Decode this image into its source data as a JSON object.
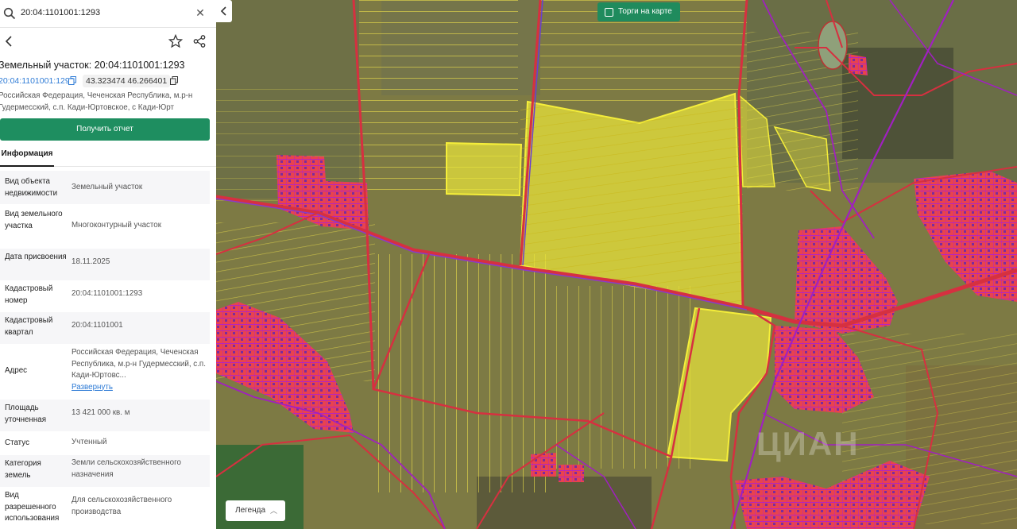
{
  "search": {
    "value": "20:04:1101001:1293"
  },
  "object": {
    "title": "Земельный участок: 20:04:1101001:1293",
    "cadastral_link": "20:04:1101001:1293",
    "coords": "43.323474 46.266401",
    "address_line1": "Российская Федерация, Чеченская Республика, м.р-н",
    "address_line2": "Гудермесский, с.п. Кади-Юртовское, с Кади-Юрт"
  },
  "report_button": "Получить отчет",
  "tabs": {
    "info": "Информация"
  },
  "info": [
    {
      "label": "Вид объекта недвижимости",
      "value": "Земельный участок"
    },
    {
      "label": "Вид земельного участка",
      "value": "Многоконтурный участок"
    },
    {
      "label": "Дата присвоения",
      "value": "18.11.2025"
    },
    {
      "label": "Кадастровый номер",
      "value": "20:04:1101001:1293"
    },
    {
      "label": "Кадастровый квартал",
      "value": "20:04:1101001"
    },
    {
      "label": "Адрес",
      "value": "Российская Федерация, Чеченская Республика, м.р-н Гудермесский, с.п. Кади-Юртовс...",
      "link": "Развернуть"
    },
    {
      "label": "Площадь уточненная",
      "value": "13 421 000 кв. м"
    },
    {
      "label": "Статус",
      "value": "Учтенный"
    },
    {
      "label": "Категория земель",
      "value": "Земли сельскохозяйственного назначения"
    },
    {
      "label": "Вид разрешенного использования",
      "value": "Для сельскохозяйственного производства"
    }
  ],
  "map": {
    "auction_toggle": "Торги на карте",
    "legend_button": "Легенда",
    "watermark": "ЦИАН",
    "colors": {
      "parcel_border": "#f0e24a",
      "selected_fill": "#e8e33a",
      "settlement": "#e0405a",
      "road": "#d63040",
      "boundary": "#a020c0",
      "accent": "#1e8e60"
    }
  }
}
